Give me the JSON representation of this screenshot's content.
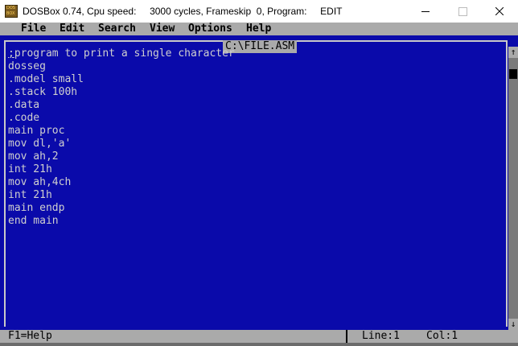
{
  "window": {
    "title": "DOSBox 0.74, Cpu speed:     3000 cycles, Frameskip  0, Program:     EDIT",
    "icons": {
      "app": "dosbox-icon",
      "minimize": "minimize-icon",
      "maximize": "maximize-icon",
      "close": "close-icon"
    }
  },
  "menu": {
    "items": [
      "File",
      "Edit",
      "Search",
      "View",
      "Options",
      "Help"
    ]
  },
  "editor": {
    "file_title": "C:\\FILE.ASM",
    "cursor_char": ";",
    "first_line_rest": "program to print a single character",
    "lines": [
      "dosseg",
      ".model small",
      ".stack 100h",
      ".data",
      ".code",
      "main proc",
      "mov dl,'a'",
      "mov ah,2",
      "int 21h",
      "mov ah,4ch",
      "int 21h",
      "main endp",
      "end main"
    ]
  },
  "scrollbar": {
    "up_glyph": "↑",
    "down_glyph": "↓"
  },
  "status": {
    "help": "F1=Help",
    "line": "Line:1",
    "col": "Col:1"
  },
  "colors": {
    "editor_bg": "#0a0aaa",
    "text": "#cfcfcf",
    "menu_bg": "#aaaaaa"
  }
}
